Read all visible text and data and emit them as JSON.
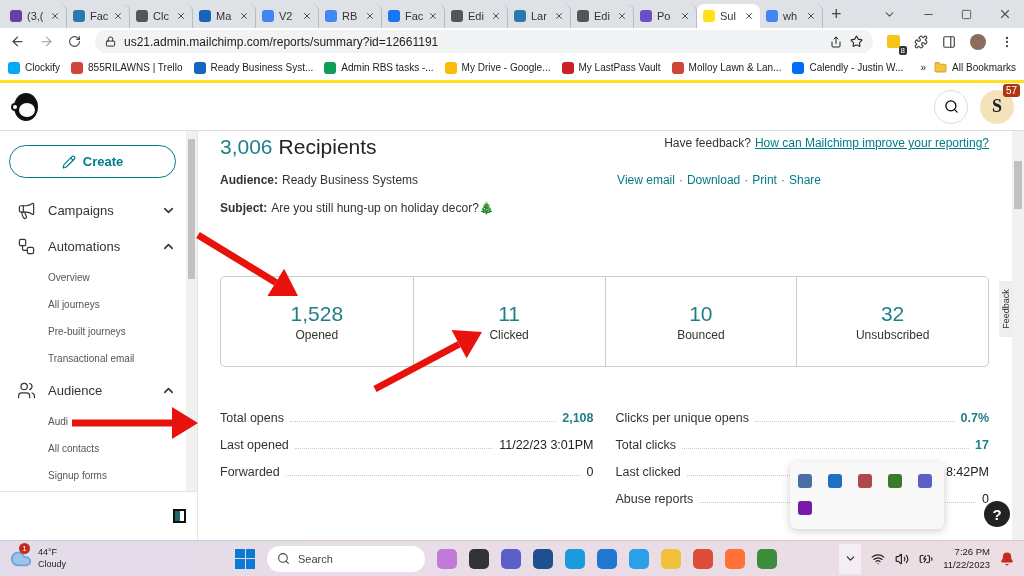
{
  "browser": {
    "tabs": [
      {
        "label": "(3,(",
        "selected": false,
        "color": "#6b3fa0"
      },
      {
        "label": "Fac",
        "selected": false,
        "color": "#2a7ab0"
      },
      {
        "label": "Clc",
        "selected": false,
        "color": "#555555"
      },
      {
        "label": "Ma",
        "selected": false,
        "color": "#1565c0"
      },
      {
        "label": "V2",
        "selected": false,
        "color": "#4285f4"
      },
      {
        "label": "RB",
        "selected": false,
        "color": "#4285f4"
      },
      {
        "label": "Fac",
        "selected": false,
        "color": "#1877f2"
      },
      {
        "label": "Edi",
        "selected": false,
        "color": "#555555"
      },
      {
        "label": "Lar",
        "selected": false,
        "color": "#2a7ab0"
      },
      {
        "label": "Edi",
        "selected": false,
        "color": "#555555"
      },
      {
        "label": "Po",
        "selected": false,
        "color": "#6a4fc2"
      },
      {
        "label": "Sul",
        "selected": true,
        "color": "#ffe01b"
      },
      {
        "label": "wh",
        "selected": false,
        "color": "#4285f4"
      }
    ],
    "new_tab": "+",
    "url": "us21.admin.mailchimp.com/reports/summary?id=12661191",
    "extension_badge": "8",
    "bookmarks": [
      {
        "label": "Clockify",
        "color": "#03a9f4"
      },
      {
        "label": "855RILAWNS | Trello",
        "color": "#d0453a"
      },
      {
        "label": "Ready Business Syst...",
        "color": "#1565c0"
      },
      {
        "label": "Admin RBS tasks -...",
        "color": "#0f9d58"
      },
      {
        "label": "My Drive - Google...",
        "color": "#fbbc04"
      },
      {
        "label": "My LastPass Vault",
        "color": "#cc2029"
      },
      {
        "label": "Molloy Lawn & Lan...",
        "color": "#d0453a"
      },
      {
        "label": "Calendly - Justin W...",
        "color": "#006bff"
      }
    ],
    "overflow": "»",
    "all_bookmarks": "All Bookmarks"
  },
  "header": {
    "avatar_letter": "S",
    "notification_count": "57"
  },
  "sidebar": {
    "create": "Create",
    "sections": [
      {
        "label": "Campaigns",
        "expanded": false
      },
      {
        "label": "Automations",
        "expanded": true,
        "children": [
          "Overview",
          "All journeys",
          "Pre-built journeys",
          "Transactional email"
        ]
      },
      {
        "label": "Audience",
        "expanded": true,
        "children": [
          "Audi",
          "All contacts",
          "Signup forms"
        ]
      }
    ]
  },
  "report": {
    "recipients_count": "3,006",
    "recipients_label": "Recipients",
    "feedback_prompt": "Have feedback?",
    "feedback_link": "How can Mailchimp improve your reporting?",
    "audience_label": "Audience:",
    "audience": "Ready Business Systems",
    "subject_label": "Subject:",
    "subject": "Are you still hung-up on holiday decor?🎄",
    "actions": [
      "View email",
      "Download",
      "Print",
      "Share"
    ],
    "separator": "·",
    "stats": [
      {
        "value": "1,528",
        "label": "Opened"
      },
      {
        "value": "11",
        "label": "Clicked"
      },
      {
        "value": "10",
        "label": "Bounced"
      },
      {
        "value": "32",
        "label": "Unsubscribed"
      }
    ],
    "left_metrics": [
      {
        "label": "Total opens",
        "value": "2,108",
        "linked": true
      },
      {
        "label": "Last opened",
        "value": "11/22/23 3:01PM",
        "linked": false
      },
      {
        "label": "Forwarded",
        "value": "0",
        "linked": false
      }
    ],
    "right_metrics": [
      {
        "label": "Clicks per unique opens",
        "value": "0.7%",
        "linked": true
      },
      {
        "label": "Total clicks",
        "value": "17",
        "linked": true
      },
      {
        "label": "Last clicked",
        "value": "8:42PM",
        "linked": false
      },
      {
        "label": "Abuse reports",
        "value": "0",
        "linked": false
      }
    ]
  },
  "feedback_tab": "Feedback",
  "help": "?",
  "taskbar": {
    "weather_badge": "1",
    "temperature": "44°F",
    "weather": "Cloudy",
    "search": "Search",
    "time": "7:26 PM",
    "date": "11/22/2023"
  }
}
